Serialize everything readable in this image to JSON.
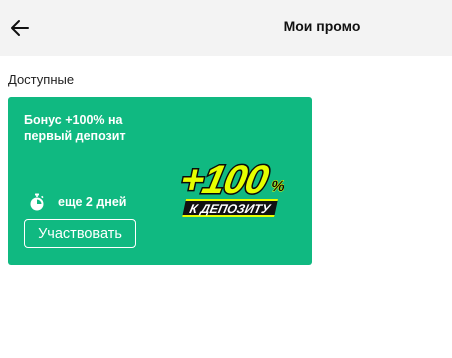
{
  "header": {
    "title": "Мои промо",
    "back_icon": "arrow-left-icon"
  },
  "section": {
    "label": "Доступные"
  },
  "promo": {
    "title": "Бонус +100% на первый депозит",
    "timer_icon": "stopwatch-icon",
    "timer_text": "еще 2 дней",
    "button_label": "Участвовать",
    "art": {
      "main_text": "+100",
      "percent": "%",
      "sub_text": "К ДЕПОЗИТУ",
      "colors": {
        "card": "#10b981",
        "main_fill": "#e6ff00",
        "outline": "#0b0b0b",
        "banner": "#111111",
        "banner_text": "#ffffff"
      }
    }
  }
}
